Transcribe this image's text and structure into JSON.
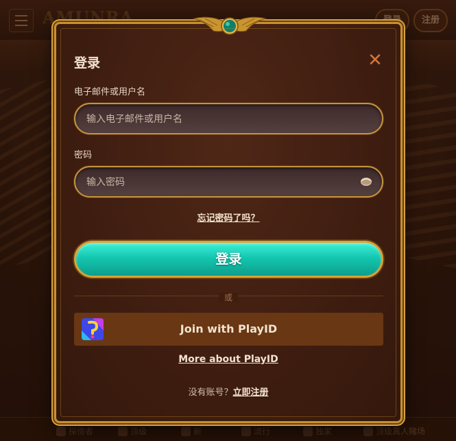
{
  "header": {
    "logo_text": "AMUNRA",
    "login_label": "登录",
    "register_label": "注册"
  },
  "bottom_nav": {
    "items": [
      "探傍者",
      "顶级",
      "新",
      "流行",
      "独家",
      "顶级真人赌场"
    ]
  },
  "modal": {
    "title": "登录",
    "close_icon": "close-icon",
    "email": {
      "label": "电子邮件或用户名",
      "placeholder": "输入电子邮件或用户名",
      "value": ""
    },
    "password": {
      "label": "密码",
      "placeholder": "输入密码",
      "value": ""
    },
    "forgot_password": "忘记密码了吗？",
    "submit_label": "登录",
    "divider_text": "或",
    "playid_label": "Join with PlayID",
    "more_about_playid": "More about PlayID",
    "no_account_text": "没有账号？",
    "register_now": "立即注册"
  },
  "colors": {
    "gold_border": "#c8912e",
    "button_teal": "#14c7b0",
    "close_orange": "#d2763a",
    "playid_bg": "#693713",
    "modal_bg": "#3e1d10"
  }
}
